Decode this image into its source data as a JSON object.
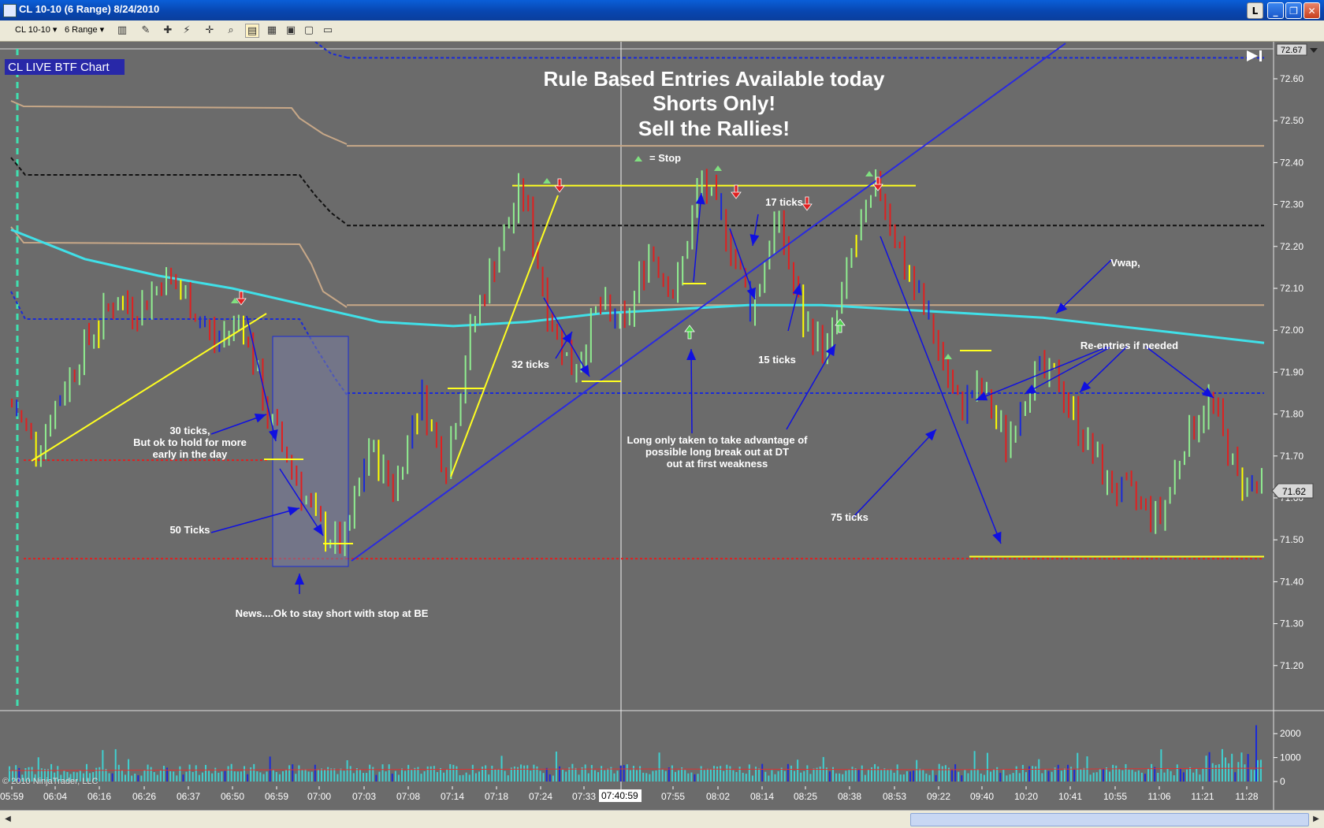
{
  "window": {
    "title": "CL 10-10 (6 Range)  8/24/2010",
    "l_button": "L",
    "min_glyph": "_",
    "max_glyph": "❐",
    "close_glyph": "✕"
  },
  "toolbar": {
    "instrument": "CL 10-10",
    "period": "6 Range"
  },
  "chart": {
    "label_box": "CL LIVE BTF Chart",
    "headline": [
      "Rule Based Entries Available today",
      "Shorts Only!",
      "Sell the Rallies!"
    ],
    "stop_legend": "= Stop",
    "copyright": "© 2010 NinjaTrader, LLC",
    "current_price": "71.62",
    "top_price": "72.67",
    "crosshair_time": "07:40:59"
  },
  "annotations": {
    "a30": [
      "30 ticks,",
      "But ok to hold for more",
      "early in the day"
    ],
    "a50": "50 Ticks",
    "news": "News....Ok to stay short with stop at BE",
    "a32": "32 ticks",
    "a17": "17 ticks",
    "a15": "15 ticks",
    "along": [
      "Long only taken to take advantage of",
      "possible long break out at DT",
      "out at first weakness"
    ],
    "a75": "75 ticks",
    "vwap": "Vwap,",
    "reentry": "Re-entries if needed"
  },
  "chart_data": {
    "type": "bar",
    "price_axis": {
      "ticks": [
        "72.60",
        "72.50",
        "72.40",
        "72.30",
        "72.20",
        "72.10",
        "72.00",
        "71.90",
        "71.80",
        "71.70",
        "71.60",
        "71.50",
        "71.40",
        "71.30",
        "71.20"
      ],
      "range": [
        71.115,
        72.695
      ]
    },
    "volume_axis": {
      "ticks": [
        "2000",
        "1000",
        "0"
      ],
      "range": [
        0,
        2900
      ]
    },
    "time_axis": [
      "05:59",
      "06:04",
      "06:16",
      "06:26",
      "06:37",
      "06:50",
      "06:59",
      "07:00",
      "07:03",
      "07:08",
      "07:14",
      "07:18",
      "07:24",
      "07:33",
      "07:55",
      "08:02",
      "08:14",
      "08:25",
      "08:38",
      "08:53",
      "09:22",
      "09:40",
      "10:20",
      "10:41",
      "10:55",
      "11:06",
      "11:21",
      "11:28"
    ],
    "price_path_approx": [
      71.82,
      71.72,
      71.86,
      71.98,
      72.07,
      72.05,
      72.13,
      72.06,
      71.97,
      72.03,
      71.8,
      71.67,
      71.53,
      71.48,
      71.72,
      71.62,
      71.85,
      71.67,
      72.0,
      72.18,
      72.34,
      72.05,
      71.9,
      72.06,
      72.0,
      72.2,
      72.08,
      72.36,
      72.24,
      72.05,
      72.27,
      72.02,
      71.95,
      72.2,
      72.35,
      72.15,
      72.02,
      71.82,
      71.86,
      71.73,
      71.9,
      71.88,
      71.75,
      71.63,
      71.6,
      71.55,
      71.74,
      71.84,
      71.65,
      71.62
    ],
    "levels": [
      {
        "value": 72.65,
        "style": "blue-dotted"
      },
      {
        "value": 72.44,
        "style": "tan"
      },
      {
        "value": 72.25,
        "style": "black-dotted"
      },
      {
        "value": 72.06,
        "style": "tan"
      },
      {
        "value": 71.85,
        "style": "blue-dotted"
      },
      {
        "value": 71.69,
        "style": "red-dotted"
      },
      {
        "value": 71.455,
        "style": "red-dotted"
      },
      {
        "value": 72.345,
        "style": "yellow"
      },
      {
        "value": 71.46,
        "style": "yellow"
      }
    ],
    "vwap_approx": [
      72.24,
      72.17,
      72.13,
      72.1,
      72.06,
      72.02,
      72.01,
      72.02,
      72.04,
      72.05,
      72.06,
      72.06,
      72.05,
      72.04,
      72.03,
      72.01,
      71.99,
      71.97
    ]
  },
  "colors": {
    "background": "#6b6b6b",
    "up_bar": "#90ee90",
    "down_bar": "#e02020",
    "swing_bar": "#1a2ad8",
    "doji_bar": "#ffff00",
    "vwap": "#40e0e8",
    "volume": "#40d0d0",
    "arrows": "#1010e0"
  }
}
